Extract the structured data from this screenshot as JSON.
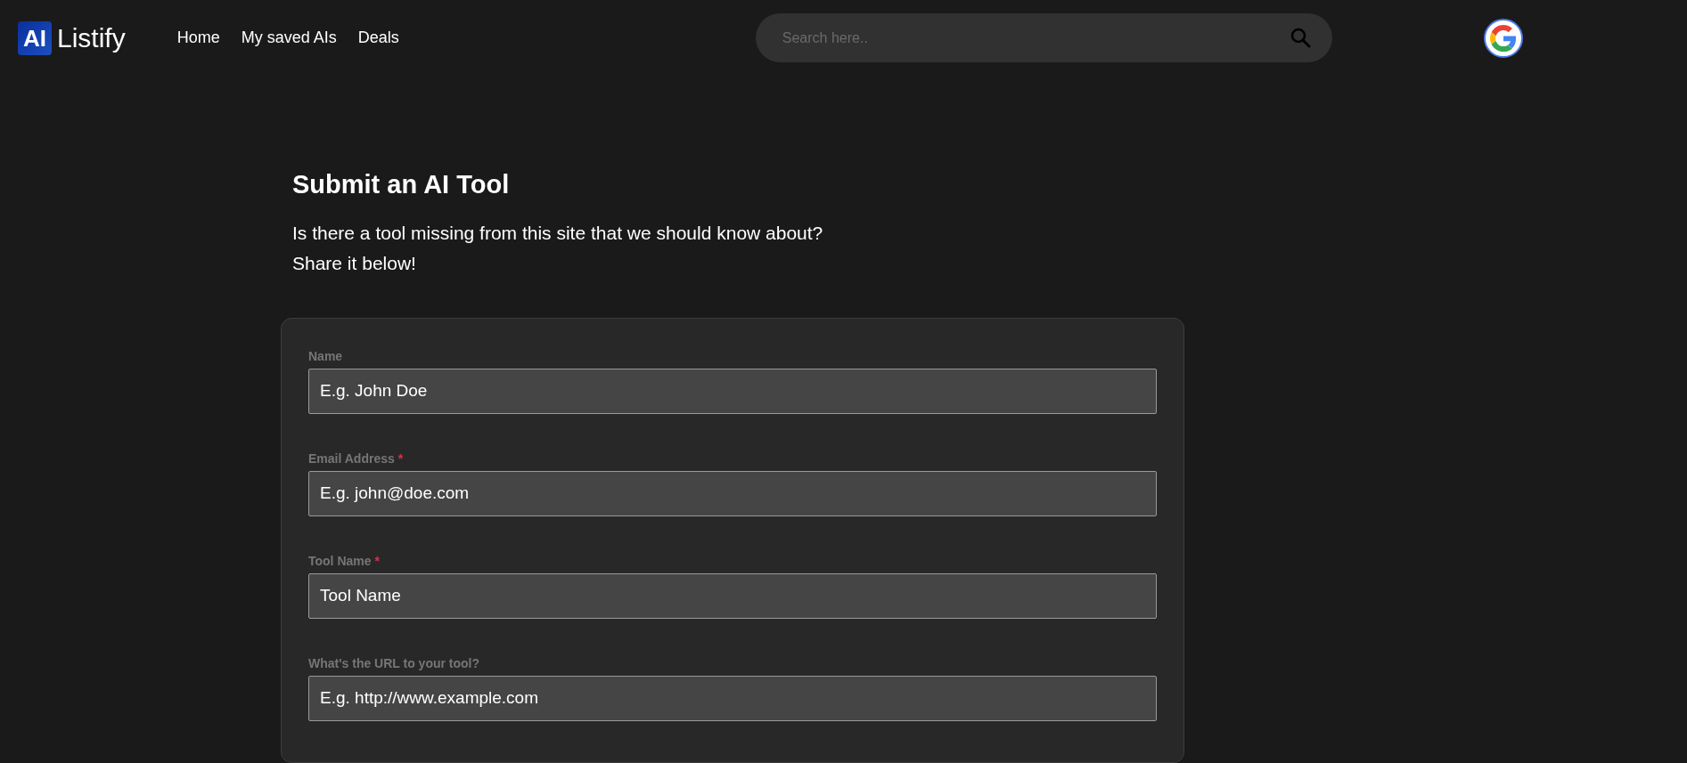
{
  "brand": {
    "badge": "AI",
    "name": "Listify"
  },
  "nav": [
    {
      "label": "Home"
    },
    {
      "label": "My saved AIs"
    },
    {
      "label": "Deals"
    }
  ],
  "search": {
    "placeholder": "Search here.."
  },
  "heading": "Submit an AI Tool",
  "intro": [
    "Is there a tool missing from this site that we should know about?",
    "Share it below!"
  ],
  "form": {
    "fields": [
      {
        "label": "Name",
        "required": false,
        "placeholder": "E.g. John Doe"
      },
      {
        "label": "Email Address",
        "required": true,
        "placeholder": "E.g. john@doe.com"
      },
      {
        "label": "Tool Name",
        "required": true,
        "placeholder": "Tool Name"
      },
      {
        "label": "What's the URL to your tool?",
        "required": false,
        "placeholder": "E.g. http://www.example.com"
      }
    ],
    "required_mark": "*"
  }
}
